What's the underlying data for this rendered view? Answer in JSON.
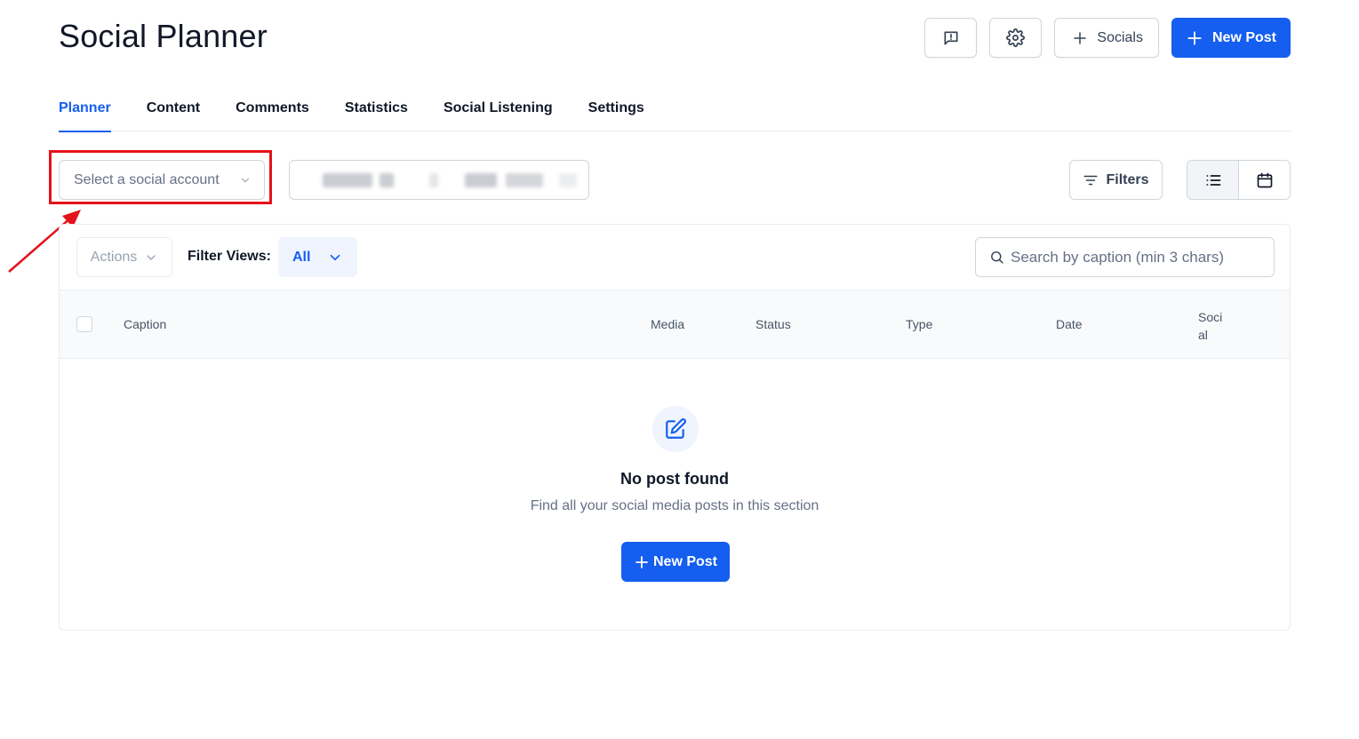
{
  "header": {
    "title": "Social Planner",
    "socials_label": "Socials",
    "new_post_label": "New Post"
  },
  "tabs": [
    {
      "label": "Planner",
      "active": true
    },
    {
      "label": "Content",
      "active": false
    },
    {
      "label": "Comments",
      "active": false
    },
    {
      "label": "Statistics",
      "active": false
    },
    {
      "label": "Social Listening",
      "active": false
    },
    {
      "label": "Settings",
      "active": false
    }
  ],
  "toolbar": {
    "account_placeholder": "Select a social account",
    "filters_label": "Filters"
  },
  "list": {
    "actions_label": "Actions",
    "filter_views_label": "Filter Views:",
    "filter_views_value": "All",
    "search_placeholder": "Search by caption (min 3 chars)",
    "columns": {
      "caption": "Caption",
      "media": "Media",
      "status": "Status",
      "type": "Type",
      "date": "Date",
      "social_1": "Soci",
      "social_2": "al"
    }
  },
  "empty_state": {
    "title": "No post found",
    "subtitle": "Find all your social media posts in this section",
    "button_label": "New Post"
  },
  "colors": {
    "primary": "#155eef",
    "highlight": "#e4121b"
  },
  "icons": [
    "report-icon",
    "gear-icon",
    "plus-icon",
    "chevron-down-icon",
    "filter-icon",
    "list-icon",
    "calendar-icon",
    "search-icon",
    "edit-icon"
  ]
}
